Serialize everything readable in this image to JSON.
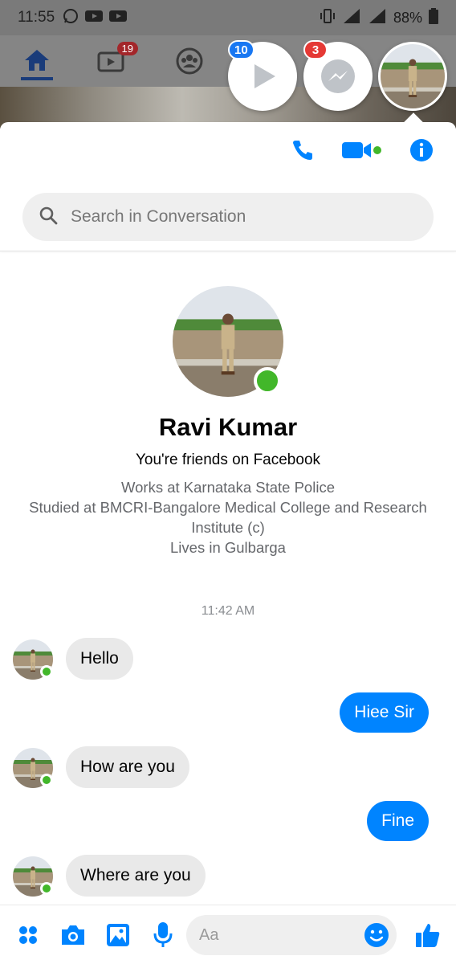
{
  "status_bar": {
    "time": "11:55",
    "battery": "88%"
  },
  "background_app": {
    "video_badge": "19"
  },
  "chat_heads": [
    {
      "name": "video-chathead",
      "badge": "10"
    },
    {
      "name": "messenger-chathead",
      "badge": "3"
    }
  ],
  "search": {
    "placeholder": "Search in Conversation"
  },
  "profile": {
    "name": "Ravi Kumar",
    "relationship": "You're friends on Facebook",
    "work": "Works at Karnataka State Police",
    "education": "Studied at BMCRI-Bangalore Medical College and Research Institute (c)",
    "lives": "Lives in Gulbarga"
  },
  "conversation": {
    "timestamp": "11:42 AM",
    "messages": [
      {
        "from": "them",
        "text": "Hello"
      },
      {
        "from": "me",
        "text": "Hiee Sir"
      },
      {
        "from": "them",
        "text": "How are you"
      },
      {
        "from": "me",
        "text": "Fine"
      },
      {
        "from": "them",
        "text": "Where are you"
      }
    ]
  },
  "composer": {
    "placeholder": "Aa"
  },
  "colors": {
    "accent": "#0084ff",
    "online": "#42b72a",
    "badge_red": "#e53935",
    "badge_blue": "#1877f2"
  }
}
